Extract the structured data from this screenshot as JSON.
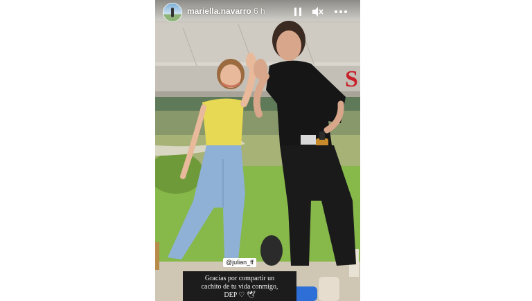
{
  "story": {
    "username": "mariella.navarro",
    "time": "6 h",
    "controls": {
      "pause_icon": "pause-icon",
      "mute_icon": "mute-icon",
      "more_icon": "more-icon"
    },
    "mention": "@julian_ff",
    "caption": {
      "line1": "Gracias por compartir un",
      "line2": "cachito de tu vida conmigo,",
      "line3": "DEP ♡ 🕊"
    }
  },
  "colors": {
    "text_on_media": "#ffffff",
    "caption_bg": "#1c1c1c"
  }
}
